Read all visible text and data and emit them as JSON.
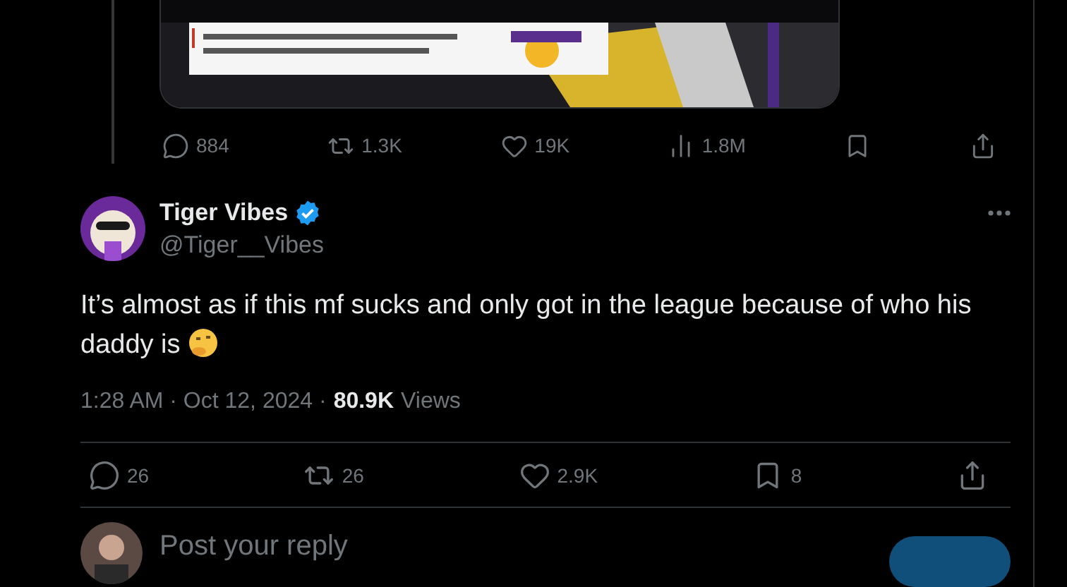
{
  "parent_actions": [
    {
      "kind": "reply",
      "count": "884"
    },
    {
      "kind": "repost",
      "count": "1.3K"
    },
    {
      "kind": "like",
      "count": "19K"
    },
    {
      "kind": "views",
      "count": "1.8M"
    },
    {
      "kind": "bookmark"
    },
    {
      "kind": "share"
    }
  ],
  "tweet": {
    "author": {
      "name": "Tiger Vibes",
      "verified": true,
      "handle": "@Tiger__Vibes"
    },
    "text": "It’s almost as if this mf sucks and only got in the league because of who his daddy is",
    "timestamp": "1:28 AM · Oct 12, 2024 · ",
    "views_count": "80.9K",
    "views_label": "Views",
    "actions": [
      {
        "kind": "reply",
        "count": "26"
      },
      {
        "kind": "repost",
        "count": "26"
      },
      {
        "kind": "like",
        "count": "2.9K"
      },
      {
        "kind": "bookmark",
        "count": "8"
      },
      {
        "kind": "share"
      }
    ]
  },
  "reply_box": {
    "placeholder": "Post your reply"
  }
}
